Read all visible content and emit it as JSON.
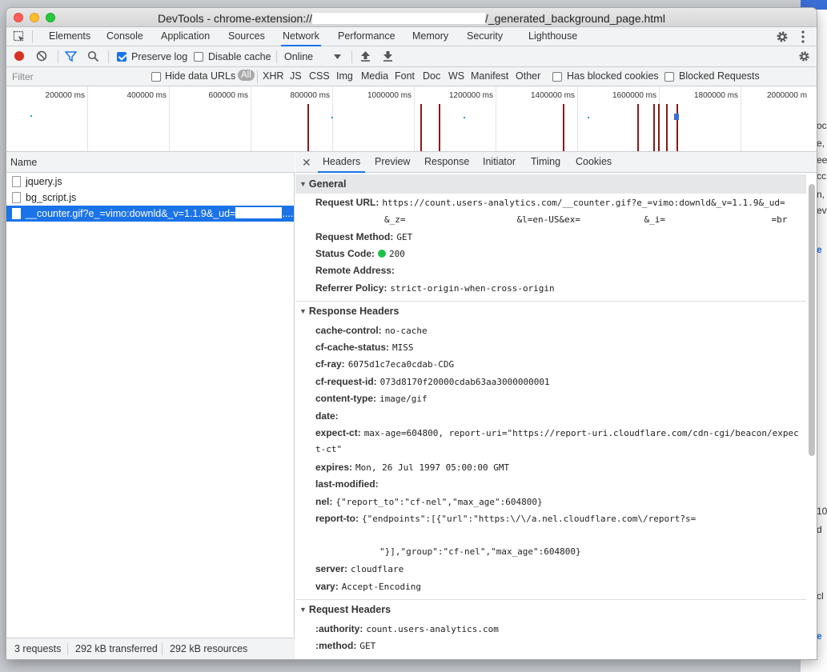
{
  "window": {
    "title_prefix": "DevTools - chrome-extension://",
    "title_suffix": "/_generated_background_page.html"
  },
  "main_tabs": [
    "Elements",
    "Console",
    "Application",
    "Sources",
    "Network",
    "Performance",
    "Memory",
    "Security",
    "Lighthouse"
  ],
  "main_tabs_active": "Network",
  "toolbar": {
    "preserve_log": "Preserve log",
    "preserve_log_checked": true,
    "disable_cache": "Disable cache",
    "disable_cache_checked": false,
    "throttling": "Online"
  },
  "filter_bar": {
    "placeholder": "Filter",
    "hide_data_urls": "Hide data URLs",
    "types": [
      "All",
      "XHR",
      "JS",
      "CSS",
      "Img",
      "Media",
      "Font",
      "Doc",
      "WS",
      "Manifest",
      "Other"
    ],
    "has_blocked_cookies": "Has blocked cookies",
    "blocked_requests": "Blocked Requests"
  },
  "overview": {
    "ticks": [
      "200000 ms",
      "400000 ms",
      "600000 ms",
      "800000 ms",
      "1000000 ms",
      "1200000 ms",
      "1400000 ms",
      "1600000 ms",
      "1800000 ms",
      "2000000 m"
    ]
  },
  "requests": {
    "column_name": "Name",
    "rows": [
      "jquery.js",
      "bg_script.js",
      "__counter.gif?e_=vimo:downld&_v=1.1.9&_ud="
    ],
    "selected_suffix": ".....",
    "status": {
      "requests": "3 requests",
      "transferred": "292 kB transferred",
      "resources": "292 kB resources"
    }
  },
  "details": {
    "tabs": [
      "Headers",
      "Preview",
      "Response",
      "Initiator",
      "Timing",
      "Cookies"
    ],
    "tabs_active": "Headers",
    "general": {
      "title": "General",
      "request_url_label": "Request URL:",
      "request_url_line1": "https://count.users-analytics.com/__counter.gif?e_=vimo:downld&_v=1.1.9&_ud=",
      "request_url_line2": "&_z=                     &l=en-US&ex=            &_i=                    =br",
      "request_method_label": "Request Method:",
      "request_method": "GET",
      "status_code_label": "Status Code:",
      "status_code": "200",
      "remote_address_label": "Remote Address:",
      "referrer_policy_label": "Referrer Policy:",
      "referrer_policy": "strict-origin-when-cross-origin"
    },
    "response_headers": {
      "title": "Response Headers",
      "items": [
        {
          "k": "cache-control:",
          "v": "no-cache"
        },
        {
          "k": "cf-cache-status:",
          "v": "MISS"
        },
        {
          "k": "cf-ray:",
          "v": "6075d1c7eca0cdab-CDG"
        },
        {
          "k": "cf-request-id:",
          "v": "073d8170f20000cdab63aa3000000001"
        },
        {
          "k": "content-type:",
          "v": "image/gif"
        },
        {
          "k": "date:",
          "v": ""
        },
        {
          "k": "expect-ct:",
          "v": "max-age=604800, report-uri=\"https://report-uri.cloudflare.com/cdn-cgi/beacon/expec"
        },
        {
          "k": "expires:",
          "v": "Mon, 26 Jul 1997 05:00:00 GMT"
        },
        {
          "k": "last-modified:",
          "v": ""
        },
        {
          "k": "nel:",
          "v": "{\"report_to\":\"cf-nel\",\"max_age\":604800}"
        },
        {
          "k": "report-to:",
          "v": "{\"endpoints\":[{\"url\":\"https:\\/\\/a.nel.cloudflare.com\\/report?s="
        },
        {
          "k": "server:",
          "v": "cloudflare"
        },
        {
          "k": "vary:",
          "v": "Accept-Encoding"
        }
      ],
      "expect_ct_cont": "t-ct\"",
      "report_to_cont": "\"}],\"group\":\"cf-nel\",\"max_age\":604800}"
    },
    "request_headers": {
      "title": "Request Headers",
      "items": [
        {
          "k": ":authority:",
          "v": "count.users-analytics.com"
        },
        {
          "k": ":method:",
          "v": "GET"
        }
      ]
    }
  },
  "background_fragments": [
    "oc",
    "e,",
    "ee",
    "cc",
    "n,",
    "ev",
    "e",
    "10",
    "d",
    "cl",
    "e"
  ]
}
